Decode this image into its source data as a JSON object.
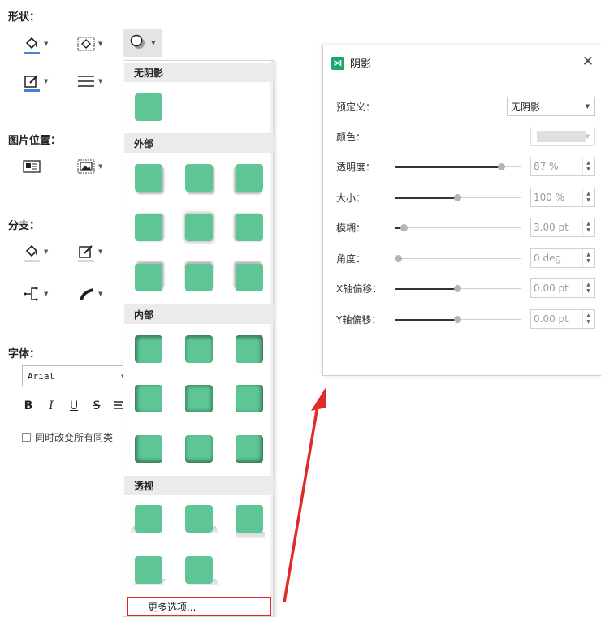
{
  "left_panel": {
    "shape_title": "形状：",
    "image_position_title": "图片位置：",
    "branch_title": "分支：",
    "font_title": "字体：",
    "font_value": "Arial",
    "sync_label": "同时改变所有同类",
    "fmt": [
      "B",
      "I",
      "U",
      "S"
    ]
  },
  "colors": {
    "accent": "#4a7fd6",
    "swatch": "#5ec695",
    "highlight": "#e12a2a",
    "brand": "#1aa86a"
  },
  "shadow_dropdown": {
    "groups": {
      "none": "无阴影",
      "outer": "外部",
      "inner": "内部",
      "perspective": "透视"
    },
    "more_options": "更多选项..."
  },
  "dialog": {
    "title": "阴影",
    "preset_label": "预定义：",
    "preset_value": "无阴影",
    "color_label": "颜色：",
    "transparency_label": "透明度：",
    "transparency_value": "87 %",
    "transparency_level": 0.87,
    "size_label": "大小：",
    "size_value": "100 %",
    "size_level": 0.5,
    "blur_label": "模糊：",
    "blur_value": "3.00 pt",
    "blur_level": 0.05,
    "angle_label": "角度：",
    "angle_value": "0 deg",
    "angle_level": 0.0,
    "xoffset_label": "X轴偏移：",
    "xoffset_value": "0.00 pt",
    "xoffset_level": 0.5,
    "yoffset_label": "Y轴偏移：",
    "yoffset_value": "0.00 pt",
    "yoffset_level": 0.5
  }
}
